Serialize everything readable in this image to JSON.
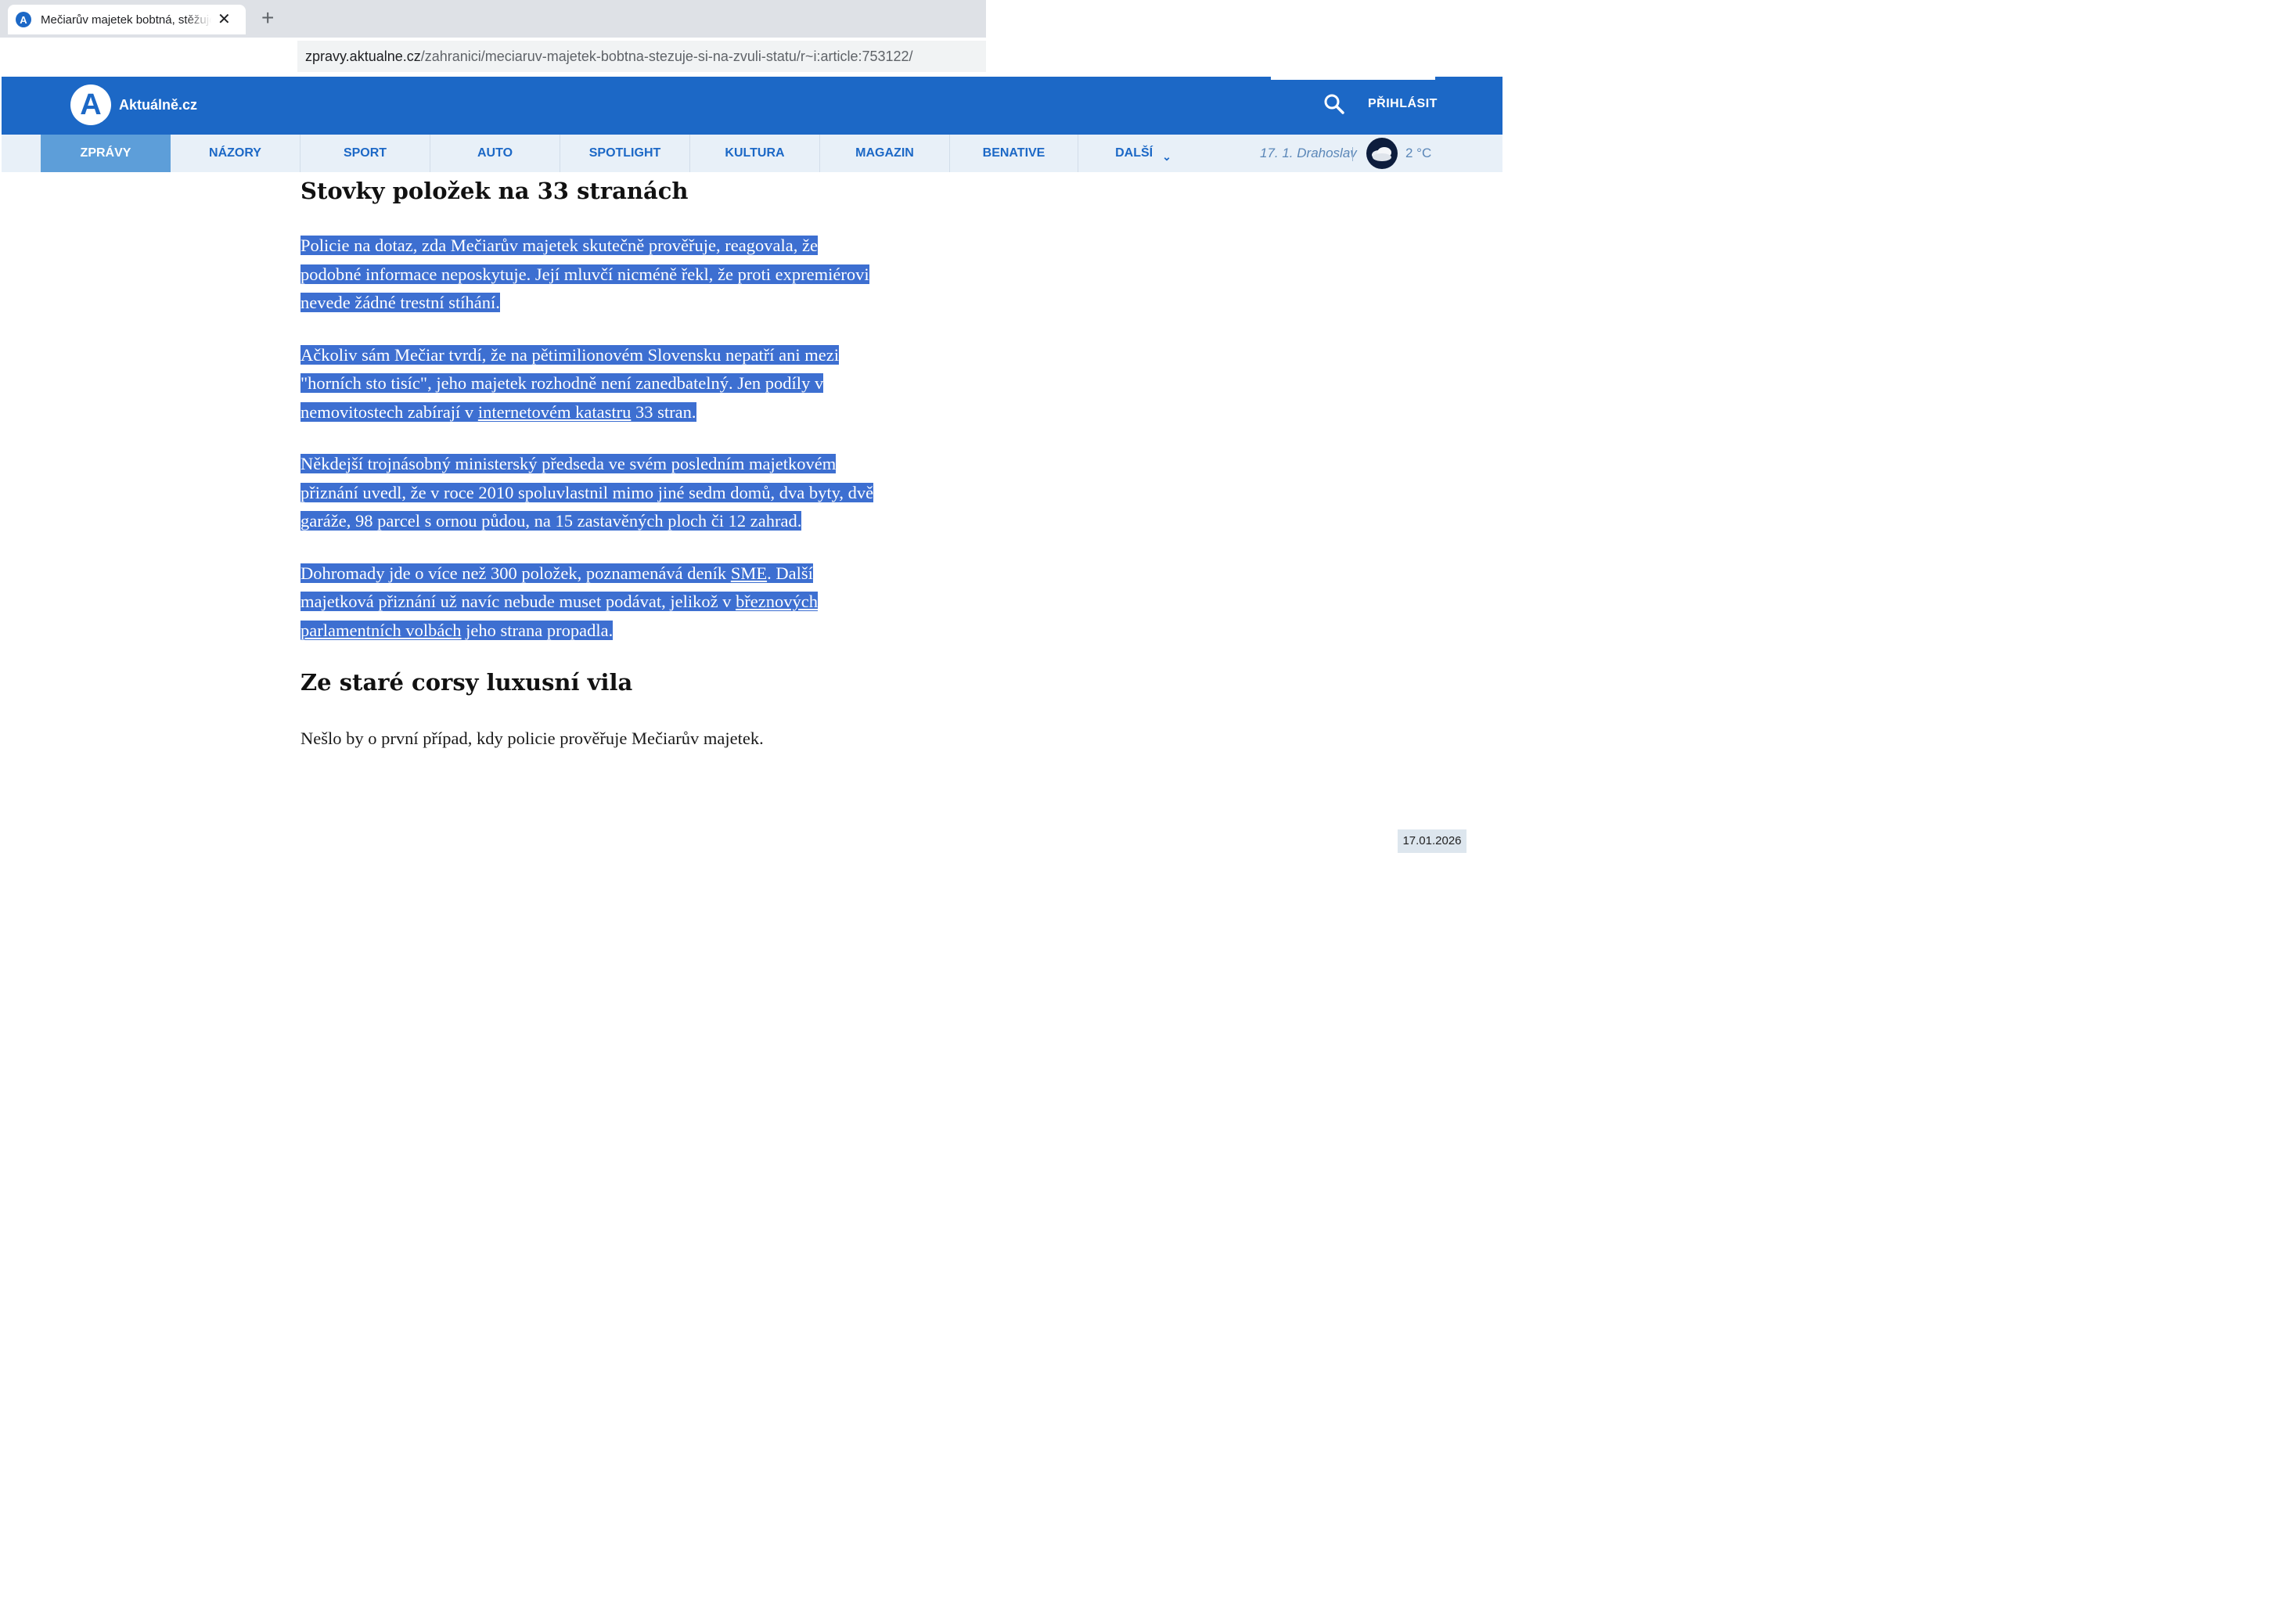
{
  "browser": {
    "tab_title": "Mečiarův majetek bobtná, stěžuje si na zvůli státu",
    "favicon_letter": "A",
    "tab_close": "✕",
    "new_tab": "+",
    "url_host": "zpravy.aktualne.cz",
    "url_path": "/zahranici/meciaruv-majetek-bobtna-stezuje-si-na-zvuli-statu/r~i:article:753122/"
  },
  "header": {
    "logo_letter": "A",
    "logo_text": "Aktuálně.cz",
    "login_label": "PŘIHLÁSIT",
    "brand_color": "#1c68c6"
  },
  "nav": {
    "items": [
      {
        "label": "ZPRÁVY",
        "active": true
      },
      {
        "label": "NÁZORY"
      },
      {
        "label": "SPORT"
      },
      {
        "label": "AUTO"
      },
      {
        "label": "SPOTLIGHT"
      },
      {
        "label": "KULTURA"
      },
      {
        "label": "MAGAZIN"
      },
      {
        "label": "BENATIVE"
      },
      {
        "label": "DALŠÍ"
      }
    ],
    "more_chevron": "⌄",
    "nameday": "17. 1. Drahoslav",
    "temperature": "2 °C",
    "weather_icon": "cloud-night-icon"
  },
  "article": {
    "heading_1": "Stovky položek na 33 stranách",
    "p1": "Policie na dotaz, zda Mečiarův majetek skutečně prověřuje, reagovala, že podobné informace neposkytuje. Její mluvčí nicméně řekl, že proti expremiérovi nevede žádné trestní stíhání.",
    "p2_before": "Ačkoliv sám Mečiar tvrdí, že na pětimilionovém Slovensku nepatří ani mezi \"horních sto tisíc\", jeho majetek rozhodně není zanedbatelný. Jen podíly v nemovitostech zabírají v ",
    "p2_link": "internetovém katastru",
    "p2_after": " 33 stran.",
    "p3": "Někdejší trojnásobný ministerský předseda ve svém posledním majetkovém přiznání uvedl, že v roce 2010 spoluvlastnil mimo jiné sedm domů, dva byty, dvě garáže, 98 parcel s ornou půdou, na 15 zastavěných ploch či 12 zahrad.",
    "p4_before": "Dohromady jde o více než 300 položek, poznamenává deník ",
    "p4_link1": "SME",
    "p4_mid": ". Další majetková přiznání už navíc nebude muset podávat, jelikož v ",
    "p4_link2": "březnových parlamentních volbách",
    "p4_after": " jeho strana propadla.",
    "heading_2": "Ze staré corsy luxusní vila",
    "p5": "Nešlo by o první případ, kdy policie prověřuje Mečiarův majetek."
  },
  "date_badge": "17.01.2026",
  "selection_color": "#3d6fd1"
}
